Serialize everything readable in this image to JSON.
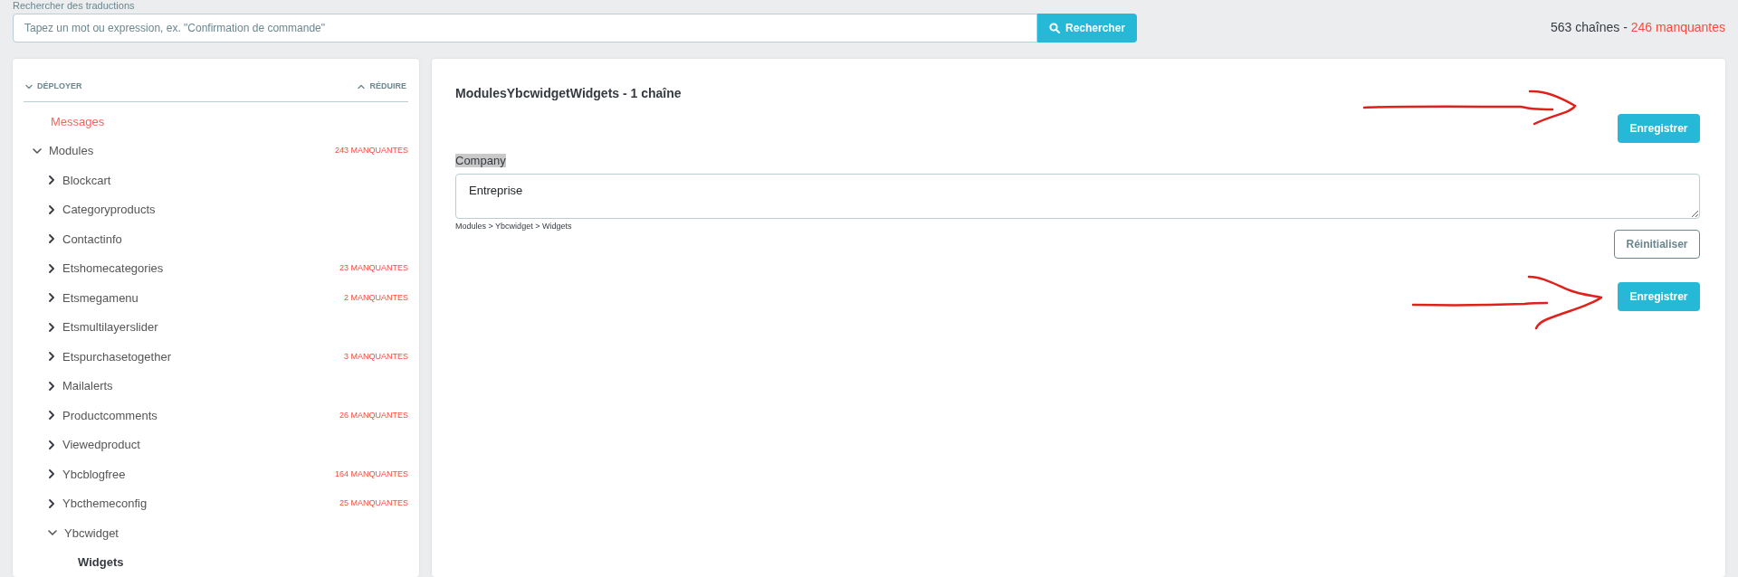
{
  "search": {
    "label": "Rechercher des traductions",
    "placeholder": "Tapez un mot ou expression, ex. \"Confirmation de commande\"",
    "button": "Rechercher"
  },
  "summary": {
    "total": "563 chaînes -",
    "missing": "246 manquantes"
  },
  "tree": {
    "expand_all": "DÉPLOYER",
    "collapse_all": "RÉDUIRE",
    "items": [
      {
        "label": "Messages",
        "selected": false,
        "color": "#f5675a"
      },
      {
        "label": "Modules",
        "selected": false,
        "expanded": true,
        "missing": "243 MANQUANTES",
        "children": [
          {
            "label": "Blockcart",
            "selected": false,
            "expanded": false
          },
          {
            "label": "Categoryproducts",
            "selected": false,
            "expanded": false
          },
          {
            "label": "Contactinfo",
            "selected": false,
            "expanded": false
          },
          {
            "label": "Etshomecategories",
            "selected": false,
            "expanded": false,
            "missing": "23 MANQUANTES"
          },
          {
            "label": "Etsmegamenu",
            "selected": false,
            "expanded": false,
            "missing": "2 MANQUANTES"
          },
          {
            "label": "Etsmultilayerslider",
            "selected": false,
            "expanded": false
          },
          {
            "label": "Etspurchasetogether",
            "selected": false,
            "expanded": false,
            "missing": "3 MANQUANTES"
          },
          {
            "label": "Mailalerts",
            "selected": false,
            "expanded": false
          },
          {
            "label": "Productcomments",
            "selected": false,
            "expanded": false,
            "missing": "26 MANQUANTES"
          },
          {
            "label": "Viewedproduct",
            "selected": false,
            "expanded": false
          },
          {
            "label": "Ybcblogfree",
            "selected": false,
            "expanded": false,
            "missing": "164 MANQUANTES"
          },
          {
            "label": "Ybcthemeconfig",
            "selected": false,
            "expanded": false,
            "missing": "25 MANQUANTES"
          },
          {
            "label": "Ybcwidget",
            "selected": false,
            "expanded": true,
            "children": [
              {
                "label": "Widgets",
                "selected": true
              }
            ]
          }
        ]
      }
    ]
  },
  "editor": {
    "title": "ModulesYbcwidgetWidgets - 1 chaîne",
    "save_button_top": "Enregistrer",
    "fields": [
      {
        "label": "Company",
        "highlighted": true,
        "value": "Entreprise",
        "path": "Modules > Ybcwidget > Widgets",
        "reset_button": "Réinitialiser"
      }
    ],
    "save_button_bottom": "Enregistrer"
  }
}
